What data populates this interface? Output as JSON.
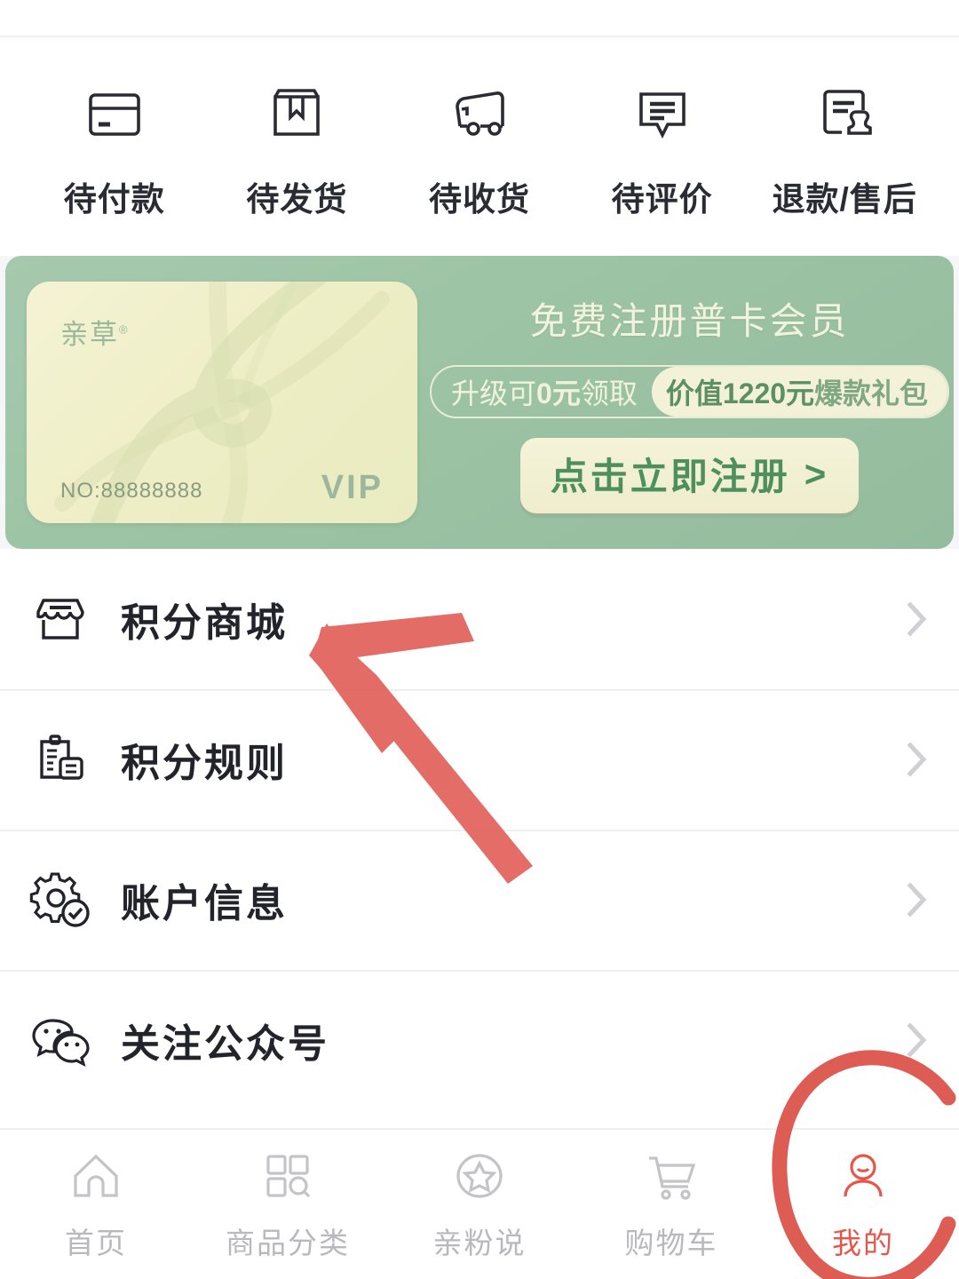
{
  "orders": {
    "items": [
      {
        "label": "待付款",
        "icon": "credit-card-icon"
      },
      {
        "label": "待发货",
        "icon": "package-box-icon"
      },
      {
        "label": "待收货",
        "icon": "delivery-truck-icon"
      },
      {
        "label": "待评价",
        "icon": "comment-lines-icon"
      },
      {
        "label": "退款/售后",
        "icon": "document-stamp-icon"
      }
    ]
  },
  "banner": {
    "card": {
      "brand": "亲草",
      "brand_mark": "®",
      "number": "NO:88888888",
      "tier": "VIP"
    },
    "title": "免费注册普卡会员",
    "promo_left_prefix": "升级可",
    "promo_left_amount": "0元",
    "promo_left_suffix": "领取",
    "promo_right_value": "价值1220元",
    "promo_right_suffix": "爆款礼包",
    "register_label": "点击立即注册",
    "register_arrow": ">",
    "colors": {
      "banner_bg": "#9cc3a4",
      "card_bg": "#f2f0cd",
      "button_text": "#4e8f5e"
    }
  },
  "menu": {
    "items": [
      {
        "label": "积分商城",
        "icon": "storefront-icon"
      },
      {
        "label": "积分规则",
        "icon": "clipboard-rules-icon"
      },
      {
        "label": "账户信息",
        "icon": "gear-check-icon"
      },
      {
        "label": "关注公众号",
        "icon": "wechat-icon"
      }
    ],
    "chevron": "›"
  },
  "bottom_nav": {
    "items": [
      {
        "label": "首页",
        "icon": "home-icon",
        "active": false
      },
      {
        "label": "商品分类",
        "icon": "grid-search-icon",
        "active": false
      },
      {
        "label": "亲粉说",
        "icon": "star-circle-icon",
        "active": false
      },
      {
        "label": "购物车",
        "icon": "shopping-cart-icon",
        "active": false
      },
      {
        "label": "我的",
        "icon": "user-person-icon",
        "active": true
      }
    ],
    "active_color": "#e7564b",
    "inactive_color": "#b9b9bd"
  },
  "annotations": {
    "arrow_color": "#e05a52",
    "circle_color": "#d94a41",
    "arrow_target": "积分商城",
    "circle_target": "我的"
  }
}
